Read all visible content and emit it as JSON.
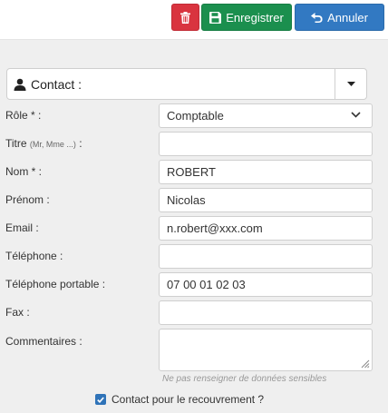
{
  "toolbar": {
    "delete_icon": "trash-icon",
    "save_label": "Enregistrer",
    "cancel_label": "Annuler",
    "colors": {
      "delete": "#d9343f",
      "save": "#1b8f4e",
      "cancel": "#3279c2"
    }
  },
  "contact_section": {
    "label": "Contact :",
    "icon": "user-icon"
  },
  "form": {
    "role": {
      "label": "Rôle * :",
      "value": "Comptable"
    },
    "titre": {
      "label": "Titre",
      "hint": "(Mr, Mme ...)",
      "suffix": " :",
      "value": ""
    },
    "nom": {
      "label": "Nom * :",
      "value": "ROBERT"
    },
    "prenom": {
      "label": "Prénom :",
      "value": "Nicolas"
    },
    "email": {
      "label": "Email :",
      "value": "n.robert@xxx.com"
    },
    "telephone": {
      "label": "Téléphone :",
      "value": ""
    },
    "telephone_portable": {
      "label": "Téléphone portable :",
      "value": "07 00 01 02 03"
    },
    "fax": {
      "label": "Fax :",
      "value": ""
    },
    "commentaires": {
      "label": "Commentaires :",
      "value": "",
      "hint": "Ne pas renseigner de données sensibles"
    },
    "recouvrement": {
      "label": "Contact pour le recouvrement ?",
      "checked": true
    }
  }
}
